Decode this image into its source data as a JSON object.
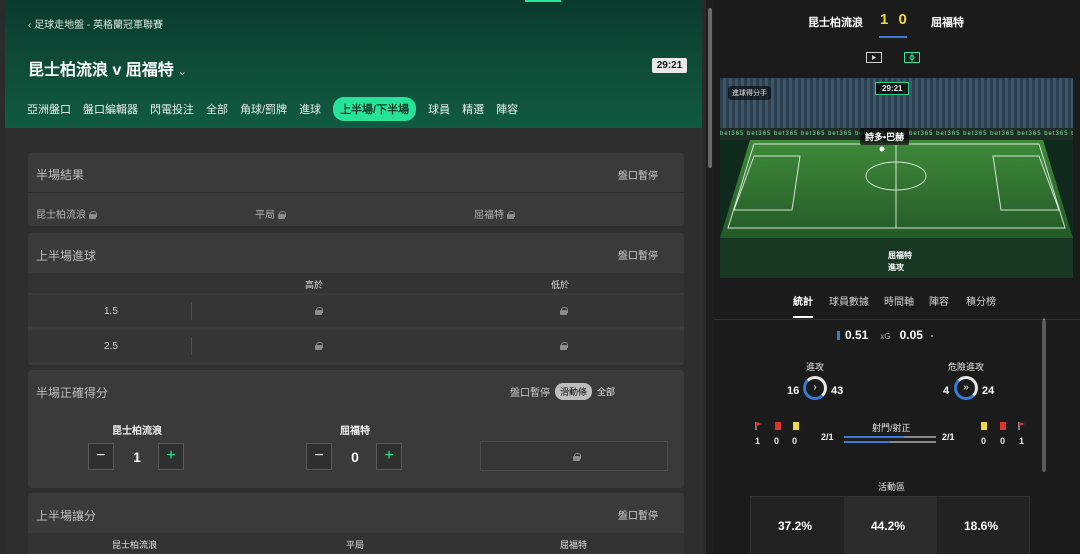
{
  "header": {
    "breadcrumb": "足球走地盤 - 英格蘭冠軍聯賽",
    "match_title": "昆士柏流浪 v 屈福特",
    "clock": "29:21",
    "tabs": [
      {
        "label": "亞洲盤口"
      },
      {
        "label": "盤口編輯器"
      },
      {
        "label": "閃電投注"
      },
      {
        "label": "全部"
      },
      {
        "label": "角球/罰牌"
      },
      {
        "label": "進球"
      },
      {
        "label": "上半場/下半場",
        "active": true
      },
      {
        "label": "球員"
      },
      {
        "label": "精選"
      },
      {
        "label": "陣容"
      }
    ]
  },
  "markets": {
    "halftime_result": {
      "title": "半場結果",
      "status": "盤口暫停",
      "home": "昆士柏流浪",
      "draw": "平局",
      "away": "屈福特"
    },
    "first_half_goals": {
      "title": "上半場進球",
      "status": "盤口暫停",
      "over": "高於",
      "under": "低於",
      "lines": [
        "1.5",
        "2.5"
      ]
    },
    "halftime_correct_score": {
      "title": "半場正確得分",
      "status": "盤口暫停",
      "toggle_label": "滑動條",
      "toggle_all": "全部",
      "home": "昆士柏流浪",
      "away": "屈福特",
      "home_value": "1",
      "away_value": "0",
      "minus": "−",
      "plus": "+"
    },
    "first_half_handicap": {
      "title": "上半場讓分",
      "status": "盤口暫停",
      "home": "昆士柏流浪",
      "draw": "平局",
      "away": "屈福特"
    }
  },
  "scoreboard": {
    "home": "昆士柏流浪",
    "score": "1 0",
    "away": "屈福特"
  },
  "pitch": {
    "badge": "進球得分手",
    "clock": "29:21",
    "player": "詩多•巴赫",
    "info_team": "屈福特",
    "info_action": "進攻",
    "adboard_text": "bet365"
  },
  "stats_tabs": [
    {
      "label": "統計",
      "active": true
    },
    {
      "label": "球員數據"
    },
    {
      "label": "時間軸"
    },
    {
      "label": "陣容"
    },
    {
      "label": "積分榜"
    }
  ],
  "stats": {
    "xg_home": "0.51",
    "xg_label": "xG",
    "xg_away": "0.05",
    "attacks_label": "進攻",
    "attacks_home": "16",
    "attacks_away": "43",
    "dangerous_label": "危險進攻",
    "dangerous_home": "4",
    "dangerous_away": "24",
    "home_corners": "1",
    "home_red": "0",
    "home_yellow": "0",
    "away_yellow": "0",
    "away_red": "0",
    "away_corners": "1",
    "shots_label": "射門/射正",
    "shots_home": "2/1",
    "shots_away": "2/1",
    "activity_label": "活動區",
    "activity": [
      "37.2%",
      "44.2%",
      "18.6%"
    ]
  },
  "colors": {
    "accent": "#27e39a",
    "home_blue": "#3a7ad6",
    "score_yellow": "#f5d63b"
  }
}
